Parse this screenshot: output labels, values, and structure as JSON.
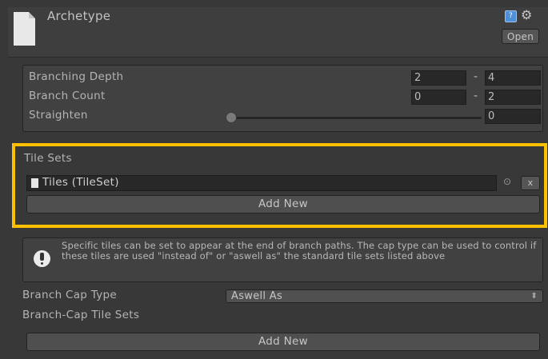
{
  "header": {
    "title": "Archetype",
    "open_label": "Open",
    "help_icon": "help-book-icon",
    "gear_icon": "gear-icon"
  },
  "settings": {
    "branching_depth": {
      "label": "Branching Depth",
      "min": "2",
      "max": "4"
    },
    "branch_count": {
      "label": "Branch Count",
      "min": "0",
      "max": "2"
    },
    "straighten": {
      "label": "Straighten",
      "value": "0",
      "slider_fraction": 0
    },
    "range_separator": "-"
  },
  "tile_sets": {
    "label": "Tile Sets",
    "item": "Tiles (TileSet)",
    "picker_glyph": "⊙",
    "remove_label": "x",
    "add_label": "Add New"
  },
  "info": {
    "text": "Specific tiles can be set to appear at the end of branch paths. The cap type can be used to control if these tiles are used \"instead of\" or \"aswell as\" the standard tile sets listed above"
  },
  "branch_cap": {
    "type_label": "Branch Cap Type",
    "type_value": "Aswell As",
    "tilesets_label": "Branch-Cap Tile Sets",
    "add_label": "Add New"
  },
  "colors": {
    "highlight": "#ffc000",
    "background": "#383838"
  }
}
